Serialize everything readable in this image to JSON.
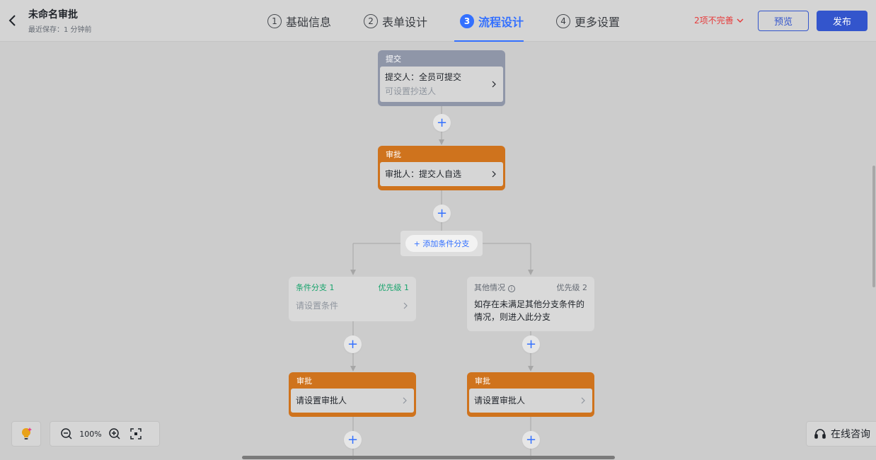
{
  "header": {
    "title": "未命名审批",
    "subtitle": "最近保存：1 分钟前",
    "steps": [
      {
        "num": "1",
        "label": "基础信息"
      },
      {
        "num": "2",
        "label": "表单设计"
      },
      {
        "num": "3",
        "label": "流程设计"
      },
      {
        "num": "4",
        "label": "更多设置"
      }
    ],
    "incomplete": "2项不完善",
    "preview": "预览",
    "publish": "发布"
  },
  "flow": {
    "submit_node": {
      "head": "提交",
      "line1": "提交人：全员可提交",
      "line2": "可设置抄送人"
    },
    "approve_node": {
      "head": "审批",
      "body": "审批人：提交人自选"
    },
    "add_branch": "+ 添加条件分支",
    "branch1": {
      "title": "条件分支 1",
      "priority": "优先级 1",
      "text": "请设置条件"
    },
    "branch2": {
      "title": "其他情况",
      "priority": "优先级 2",
      "text": "如存在未满足其他分支条件的情况，则进入此分支"
    },
    "approve_left": {
      "head": "审批",
      "body": "请设置审批人"
    },
    "approve_right": {
      "head": "审批",
      "body": "请设置审批人"
    }
  },
  "toolbar": {
    "zoom": "100%",
    "consult": "在线咨询"
  },
  "colors": {
    "accent": "#3370ff",
    "approve": "#cf731d",
    "submit": "#8f96a8",
    "warning": "#e63b3b"
  }
}
